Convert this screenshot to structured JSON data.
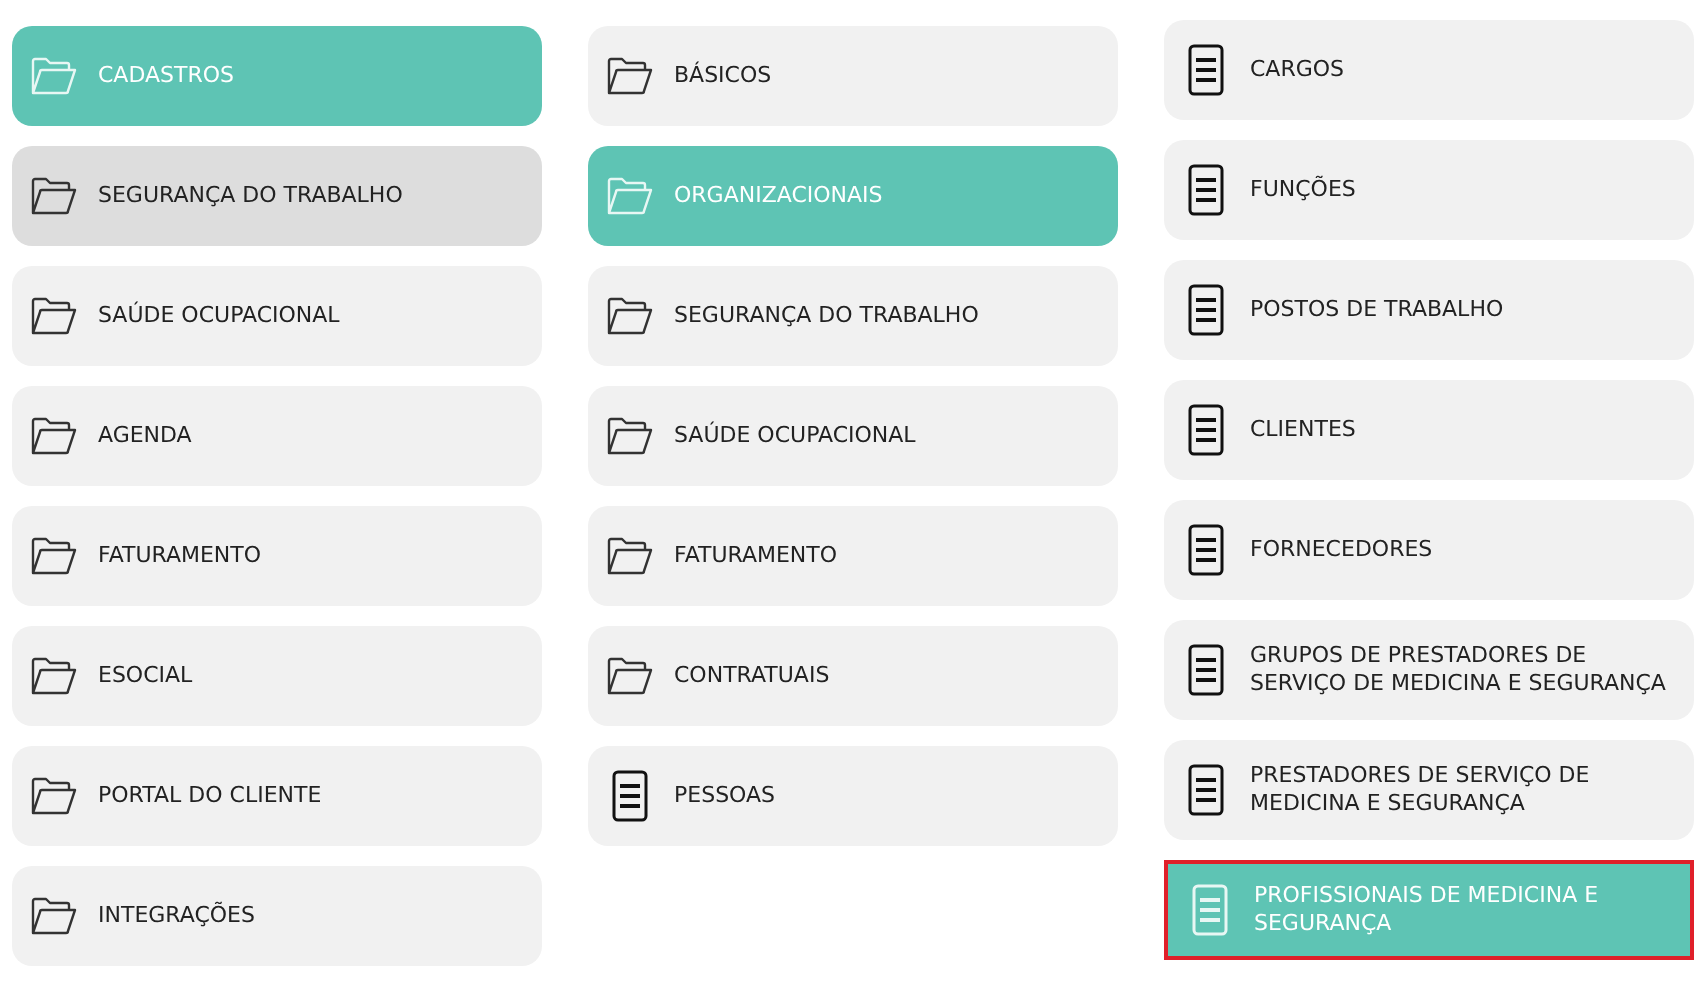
{
  "columns": [
    {
      "items": [
        {
          "label": "CADASTROS",
          "kind": "folder",
          "selected": true,
          "hovered": false,
          "focused": false
        },
        {
          "label": "SEGURANÇA DO TRABALHO",
          "kind": "folder",
          "selected": false,
          "hovered": true,
          "focused": false
        },
        {
          "label": "SAÚDE OCUPACIONAL",
          "kind": "folder",
          "selected": false,
          "hovered": false,
          "focused": false
        },
        {
          "label": "AGENDA",
          "kind": "folder",
          "selected": false,
          "hovered": false,
          "focused": false
        },
        {
          "label": "FATURAMENTO",
          "kind": "folder",
          "selected": false,
          "hovered": false,
          "focused": false
        },
        {
          "label": "ESOCIAL",
          "kind": "folder",
          "selected": false,
          "hovered": false,
          "focused": false
        },
        {
          "label": "PORTAL DO CLIENTE",
          "kind": "folder",
          "selected": false,
          "hovered": false,
          "focused": false
        },
        {
          "label": "INTEGRAÇÕES",
          "kind": "folder",
          "selected": false,
          "hovered": false,
          "focused": false
        }
      ]
    },
    {
      "items": [
        {
          "label": "BÁSICOS",
          "kind": "folder",
          "selected": false,
          "hovered": false,
          "focused": false
        },
        {
          "label": "ORGANIZACIONAIS",
          "kind": "folder",
          "selected": true,
          "hovered": false,
          "focused": false
        },
        {
          "label": "SEGURANÇA DO TRABALHO",
          "kind": "folder",
          "selected": false,
          "hovered": false,
          "focused": false
        },
        {
          "label": "SAÚDE OCUPACIONAL",
          "kind": "folder",
          "selected": false,
          "hovered": false,
          "focused": false
        },
        {
          "label": "FATURAMENTO",
          "kind": "folder",
          "selected": false,
          "hovered": false,
          "focused": false
        },
        {
          "label": "CONTRATUAIS",
          "kind": "folder",
          "selected": false,
          "hovered": false,
          "focused": false
        },
        {
          "label": "PESSOAS",
          "kind": "document",
          "selected": false,
          "hovered": false,
          "focused": false
        }
      ]
    },
    {
      "items": [
        {
          "label": "CARGOS",
          "kind": "document",
          "selected": false,
          "hovered": false,
          "focused": false
        },
        {
          "label": "FUNÇÕES",
          "kind": "document",
          "selected": false,
          "hovered": false,
          "focused": false
        },
        {
          "label": "POSTOS DE TRABALHO",
          "kind": "document",
          "selected": false,
          "hovered": false,
          "focused": false
        },
        {
          "label": "CLIENTES",
          "kind": "document",
          "selected": false,
          "hovered": false,
          "focused": false
        },
        {
          "label": "FORNECEDORES",
          "kind": "document",
          "selected": false,
          "hovered": false,
          "focused": false
        },
        {
          "label": "GRUPOS DE PRESTADORES DE SERVIÇO DE MEDICINA E SEGURANÇA",
          "kind": "document",
          "selected": false,
          "hovered": false,
          "focused": false
        },
        {
          "label": "PRESTADORES DE SERVIÇO DE MEDICINA E SEGURANÇA",
          "kind": "document",
          "selected": false,
          "hovered": false,
          "focused": false
        },
        {
          "label": "PROFISSIONAIS DE MEDICINA E SEGURANÇA",
          "kind": "document",
          "selected": true,
          "hovered": false,
          "focused": true
        }
      ]
    }
  ]
}
